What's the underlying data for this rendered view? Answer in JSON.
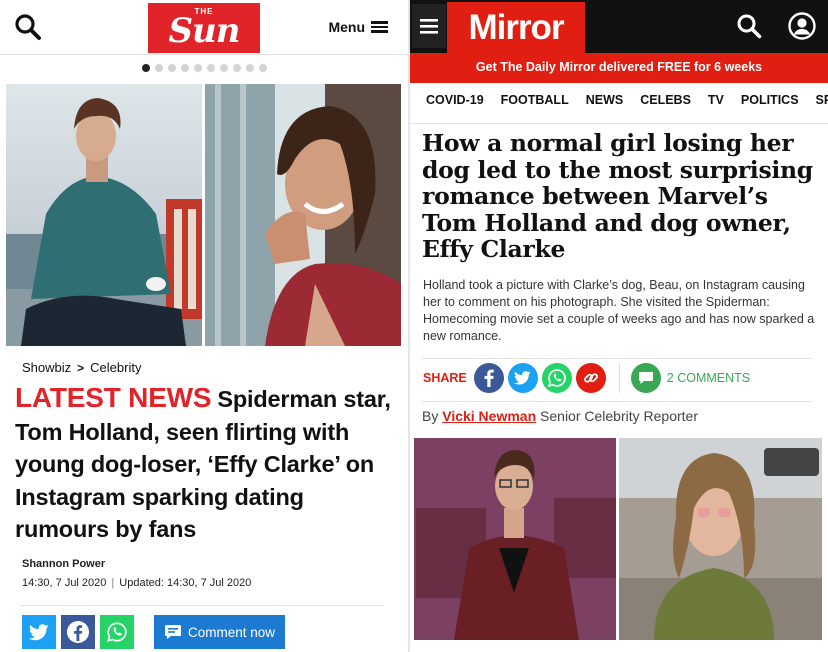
{
  "sun": {
    "logo_small": "THE",
    "logo": "Sun",
    "menu_label": "Menu",
    "carousel": {
      "total": 10,
      "active": 1
    },
    "breadcrumb": {
      "section": "Showbiz",
      "separator": ">",
      "subsection": "Celebrity"
    },
    "kicker": "LATEST NEWS",
    "headline": "Spiderman star, Tom Holland, seen flirting with young dog-loser, ‘Effy Clarke’ on Instagram sparking dating rumours by fans",
    "author": "Shannon Power",
    "published": "14:30, 7 Jul 2020",
    "separator": "|",
    "updated": "Updated: 14:30, 7 Jul 2020",
    "comment_label": "Comment now"
  },
  "mirror": {
    "logo": "Mirror",
    "promo": "Get The Daily Mirror delivered FREE for 6 weeks",
    "nav": [
      "COVID-19",
      "FOOTBALL",
      "NEWS",
      "CELEBS",
      "TV",
      "POLITICS",
      "SPO"
    ],
    "headline": "How a normal girl losing her dog led to the most surprising romance between Marvel’s Tom Holland and dog owner, Effy Clarke",
    "standfirst": "Holland took a picture with Clarke’s dog, Beau, on Instagram causing her to comment on his photograph. She visited the Spiderman: Homecoming movie set a couple of weeks ago and has now sparked a new romance.",
    "share_label": "SHARE",
    "comments_label": "2 COMMENTS",
    "byline_prefix": "By",
    "author": "Vicki Newman",
    "author_role": "Senior Celebrity Reporter"
  },
  "colors": {
    "sun_red": "#e1242a",
    "mirror_red": "#e01e12",
    "facebook": "#3b5998",
    "twitter": "#1da1f2",
    "whatsapp": "#25d366",
    "comment_blue": "#1c7ad0",
    "comment_green": "#3aa757"
  }
}
